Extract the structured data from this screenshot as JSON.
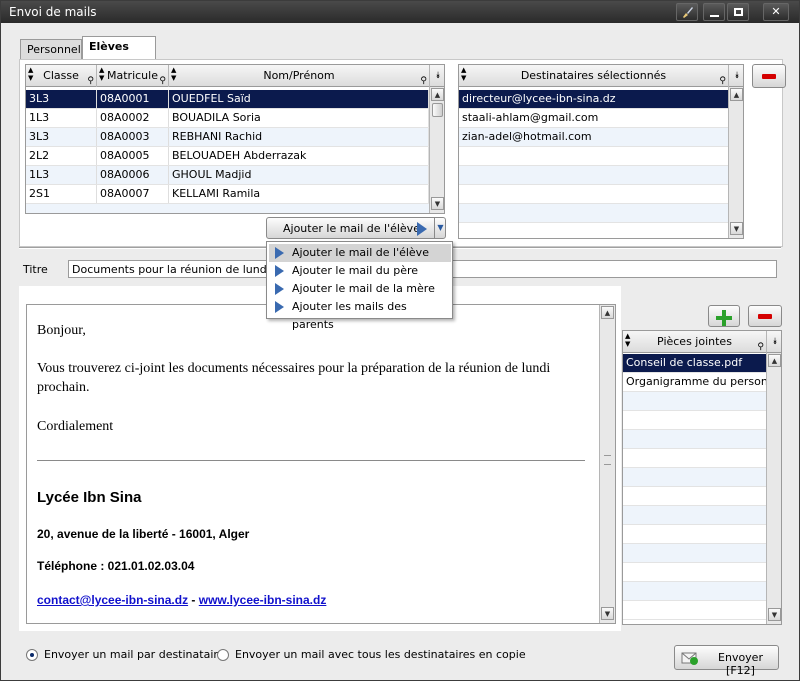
{
  "window": {
    "title": "Envoi de mails"
  },
  "title_buttons": [
    "brush-icon",
    "minimize-icon",
    "maximize-icon",
    "close-icon"
  ],
  "tabs": [
    {
      "label": "Personnel",
      "active": false
    },
    {
      "label": "Elèves",
      "active": true
    }
  ],
  "students_grid": {
    "columns": [
      "Classe",
      "Matricule",
      "Nom/Prénom"
    ],
    "rows": [
      {
        "classe": "3L3",
        "matricule": "08A0001",
        "nom": "OUEDFEL Saïd",
        "selected": true
      },
      {
        "classe": "1L3",
        "matricule": "08A0002",
        "nom": "BOUADILA Soria"
      },
      {
        "classe": "3L3",
        "matricule": "08A0003",
        "nom": "REBHANI Rachid"
      },
      {
        "classe": "2L2",
        "matricule": "08A0005",
        "nom": "BELOUADEH Abderrazak"
      },
      {
        "classe": "1L3",
        "matricule": "08A0006",
        "nom": "GHOUL Madjid"
      },
      {
        "classe": "2S1",
        "matricule": "08A0007",
        "nom": "KELLAMI Ramila"
      }
    ]
  },
  "add_button": {
    "label": "Ajouter le mail de l'élève"
  },
  "add_menu": {
    "items": [
      "Ajouter le mail de l'élève",
      "Ajouter le mail du père",
      "Ajouter le mail de la mère",
      "Ajouter les mails des parents"
    ],
    "highlighted": 0
  },
  "recipients_grid": {
    "column": "Destinataires sélectionnés",
    "rows": [
      {
        "email": "directeur@lycee-ibn-sina.dz",
        "selected": true
      },
      {
        "email": "staali-ahlam@gmail.com"
      },
      {
        "email": "zian-adel@hotmail.com"
      }
    ]
  },
  "subject": {
    "label": "Titre",
    "value": "Documents pour la réunion de lundi"
  },
  "message": {
    "greeting": "Bonjour,",
    "body": "Vous trouverez ci-joint les documents nécessaires pour la préparation de la réunion de lundi prochain.",
    "closing": "Cordialement",
    "signature": {
      "name": "Lycée Ibn Sina",
      "address": "20, avenue de la liberté - 16001, Alger",
      "phone": "Téléphone : 021.01.02.03.04",
      "email": "contact@lycee-ibn-sina.dz",
      "separator": "-",
      "website": "www.lycee-ibn-sina.dz"
    }
  },
  "attachments_grid": {
    "column": "Pièces jointes",
    "rows": [
      {
        "name": "Conseil de classe.pdf",
        "selected": true
      },
      {
        "name": "Organigramme du personn..."
      }
    ]
  },
  "send_options": {
    "one_per_recipient": {
      "label": "Envoyer un mail par destinataire",
      "checked": true
    },
    "all_in_copy": {
      "label": "Envoyer un mail avec tous les destinataires en copie",
      "checked": false
    }
  },
  "send_button": {
    "label": "Envoyer [F12]"
  },
  "colors": {
    "selection": "#0b1a4d",
    "remove": "#d40000",
    "add": "#2aa12a",
    "link": "#1010cc"
  }
}
